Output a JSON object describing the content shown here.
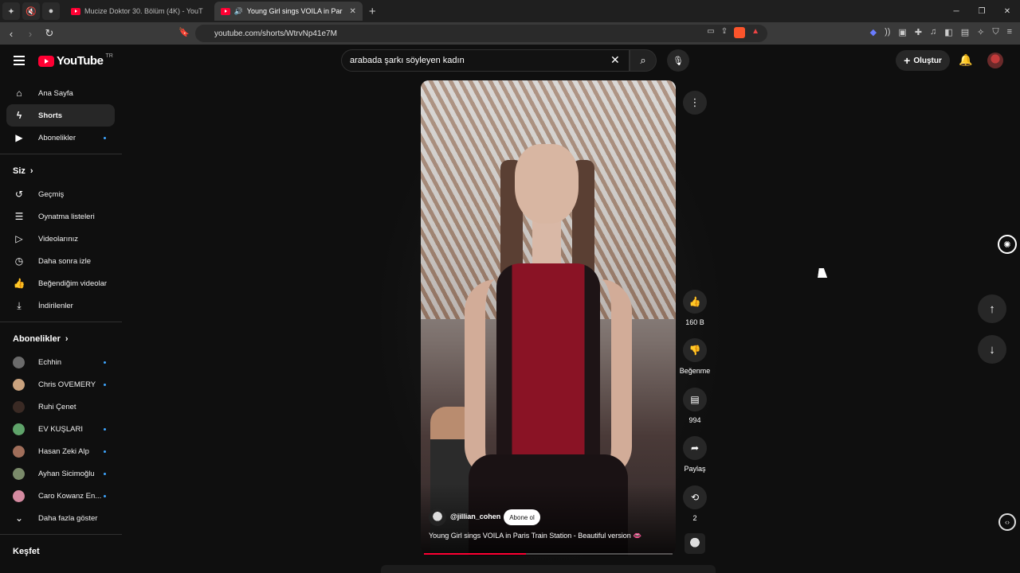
{
  "browser": {
    "tabs": [
      {
        "title": "Mucize Doktor 30. Bölüm (4K) - YouT",
        "active": false
      },
      {
        "title": "Young Girl sings VOILA in Par",
        "active": true
      }
    ],
    "url": "youtube.com/shorts/WtrvNp41e7M"
  },
  "header": {
    "logo_text": "YouTube",
    "logo_region": "TR",
    "search_value": "arabada şarkı söyleyen kadın",
    "create_label": "Oluştur"
  },
  "sidebar": {
    "main": [
      {
        "label": "Ana Sayfa",
        "icon": "home-icon"
      },
      {
        "label": "Shorts",
        "icon": "shorts-icon",
        "active": true
      },
      {
        "label": "Abonelikler",
        "icon": "subscriptions-icon",
        "dot": true
      }
    ],
    "you_heading": "Siz",
    "you": [
      {
        "label": "Geçmiş",
        "icon": "history-icon"
      },
      {
        "label": "Oynatma listeleri",
        "icon": "playlists-icon"
      },
      {
        "label": "Videolarınız",
        "icon": "your-videos-icon"
      },
      {
        "label": "Daha sonra izle",
        "icon": "watch-later-icon"
      },
      {
        "label": "Beğendiğim videolar",
        "icon": "liked-icon"
      },
      {
        "label": "İndirilenler",
        "icon": "downloads-icon"
      }
    ],
    "subs_heading": "Abonelikler",
    "subscriptions": [
      {
        "label": "Echhin",
        "dot": true,
        "color": "#6b6b6b"
      },
      {
        "label": "Chris OVEMERY",
        "dot": true,
        "color": "#c9a27e"
      },
      {
        "label": "Ruhi Çenet",
        "dot": false,
        "color": "#3a2a24"
      },
      {
        "label": "EV KUŞLARI",
        "dot": true,
        "color": "#5fa36a"
      },
      {
        "label": "Hasan Zeki Alp",
        "dot": true,
        "color": "#a06e5a"
      },
      {
        "label": "Ayhan Sicimoğlu",
        "dot": true,
        "color": "#7a8a6a"
      },
      {
        "label": "Caro Kowanz En...",
        "dot": true,
        "color": "#d48aa0"
      }
    ],
    "show_more": "Daha fazla göster",
    "explore_heading": "Keşfet"
  },
  "short": {
    "channel": "@jillian_cohen",
    "subscribe_label": "Abone ol",
    "title": "Young Girl sings VOILA in Paris Train Station - Beautiful version 👄",
    "progress": 0.41
  },
  "actions": {
    "likes": "160 B",
    "dislike": "Beğenme",
    "comments": "994",
    "share": "Paylaş",
    "remix": "2"
  }
}
